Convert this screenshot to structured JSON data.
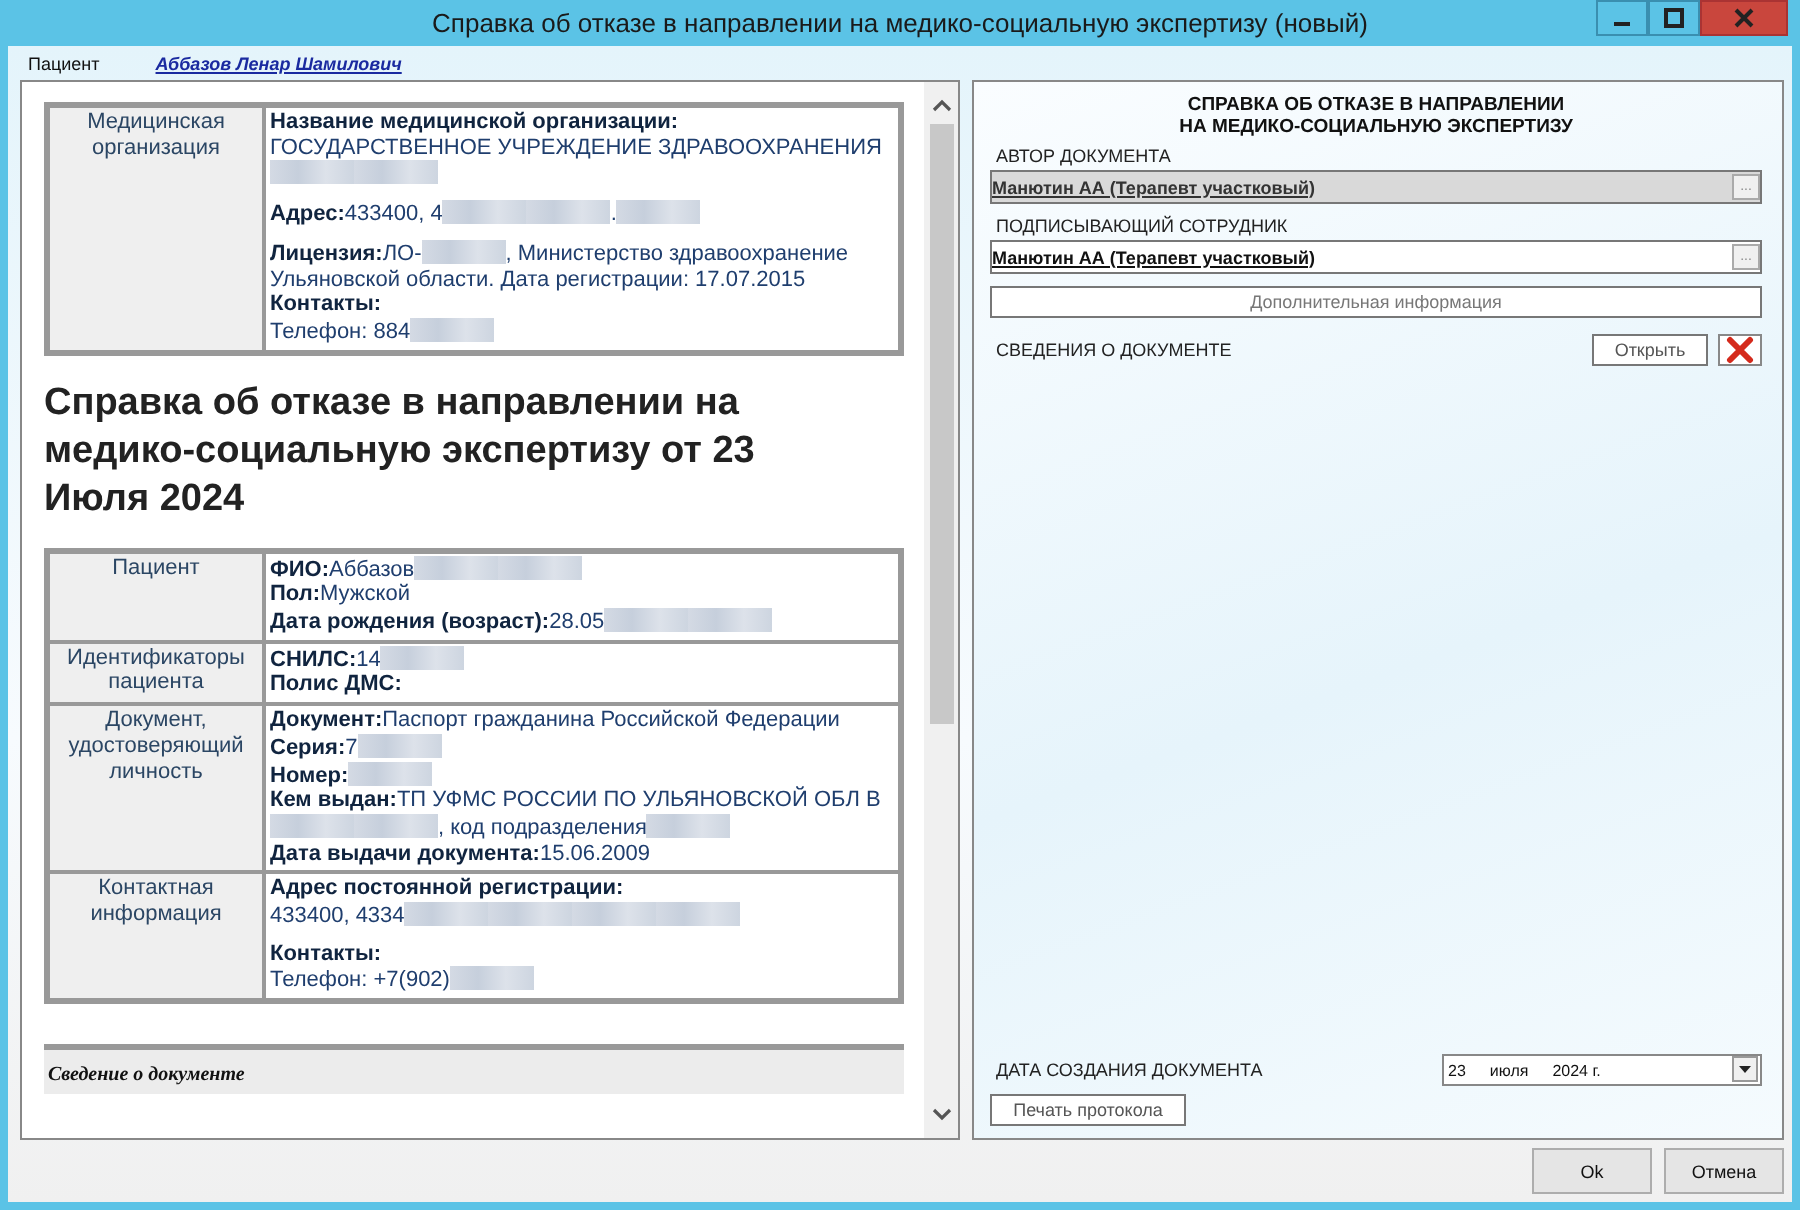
{
  "window": {
    "title": "Справка об отказе в направлении на медико-социальную экспертизу (новый)"
  },
  "patient": {
    "label": "Пациент",
    "name": "Аббазов Ленар Шамилович"
  },
  "document": {
    "org_table": [
      {
        "label": "Медицинская организация",
        "lines": [
          {
            "gap_before": false,
            "parts": [
              {
                "kind": "key",
                "text": "Название медицинской организации:"
              }
            ]
          },
          {
            "gap_before": false,
            "parts": [
              {
                "kind": "text",
                "text": "ГОСУДАРСТВЕННОЕ УЧРЕЖДЕНИЕ ЗДРАВООХРАНЕНИЯ"
              },
              {
                "kind": "blur"
              },
              {
                "kind": "blur"
              }
            ]
          },
          {
            "gap_before": true,
            "parts": [
              {
                "kind": "key",
                "text": "Адрес:"
              },
              {
                "kind": "text",
                "text": "433400, 4"
              },
              {
                "kind": "blur"
              },
              {
                "kind": "blur"
              },
              {
                "kind": "text",
                "text": "."
              },
              {
                "kind": "blur"
              }
            ]
          },
          {
            "gap_before": true,
            "parts": [
              {
                "kind": "key",
                "text": "Лицензия:"
              },
              {
                "kind": "text",
                "text": "ЛО-"
              },
              {
                "kind": "blur"
              },
              {
                "kind": "text",
                "text": ", Министерство здравоохранение Ульяновской области. Дата регистрации: 17.07.2015"
              }
            ]
          },
          {
            "gap_before": false,
            "parts": [
              {
                "kind": "key",
                "text": "Контакты:"
              }
            ]
          },
          {
            "gap_before": false,
            "parts": [
              {
                "kind": "text",
                "text": "Телефон: 884"
              },
              {
                "kind": "blur"
              }
            ]
          }
        ]
      }
    ],
    "heading": "Справка об отказе в направлении на медико-социальную экспертизу от 23 Июля 2024",
    "patient_table": [
      {
        "label": "Пациент",
        "lines": [
          {
            "gap_before": false,
            "parts": [
              {
                "kind": "key",
                "text": "ФИО:"
              },
              {
                "kind": "text",
                "text": "Аббазов"
              },
              {
                "kind": "blur"
              },
              {
                "kind": "blur"
              }
            ]
          },
          {
            "gap_before": false,
            "parts": [
              {
                "kind": "key",
                "text": "Пол:"
              },
              {
                "kind": "text",
                "text": "Мужской"
              }
            ]
          },
          {
            "gap_before": false,
            "parts": [
              {
                "kind": "key",
                "text": "Дата рождения (возраст):"
              },
              {
                "kind": "text",
                "text": "28.05"
              },
              {
                "kind": "blur"
              },
              {
                "kind": "blur"
              }
            ]
          }
        ]
      },
      {
        "label": "Идентификаторы пациента",
        "lines": [
          {
            "gap_before": false,
            "parts": [
              {
                "kind": "key",
                "text": "СНИЛС:"
              },
              {
                "kind": "text",
                "text": "14"
              },
              {
                "kind": "blur"
              }
            ]
          },
          {
            "gap_before": false,
            "parts": [
              {
                "kind": "key",
                "text": "Полис ДМС:"
              }
            ]
          }
        ]
      },
      {
        "label": "Документ, удостоверяющий личность",
        "lines": [
          {
            "gap_before": false,
            "parts": [
              {
                "kind": "key",
                "text": "Документ:"
              },
              {
                "kind": "text",
                "text": "Паспорт гражданина Российской Федерации"
              }
            ]
          },
          {
            "gap_before": false,
            "parts": [
              {
                "kind": "key",
                "text": "Серия:"
              },
              {
                "kind": "text",
                "text": "7"
              },
              {
                "kind": "blur"
              }
            ]
          },
          {
            "gap_before": false,
            "parts": [
              {
                "kind": "key",
                "text": "Номер:"
              },
              {
                "kind": "blur"
              }
            ]
          },
          {
            "gap_before": false,
            "parts": [
              {
                "kind": "key",
                "text": "Кем выдан:"
              },
              {
                "kind": "text",
                "text": "ТП УФМС РОССИИ ПО УЛЬЯНОВСКОЙ ОБЛ В"
              },
              {
                "kind": "blur"
              },
              {
                "kind": "blur"
              },
              {
                "kind": "text",
                "text": ", код подразделения"
              },
              {
                "kind": "blur"
              }
            ]
          },
          {
            "gap_before": false,
            "parts": [
              {
                "kind": "key",
                "text": "Дата выдачи документа:"
              },
              {
                "kind": "text",
                "text": "15.06.2009"
              }
            ]
          }
        ]
      },
      {
        "label": "Контактная информация",
        "lines": [
          {
            "gap_before": false,
            "parts": [
              {
                "kind": "key",
                "text": "Адрес постоянной регистрации:"
              }
            ]
          },
          {
            "gap_before": false,
            "parts": [
              {
                "kind": "text",
                "text": "433400, 4334"
              },
              {
                "kind": "blur"
              },
              {
                "kind": "blur"
              },
              {
                "kind": "blur"
              },
              {
                "kind": "blur"
              }
            ]
          },
          {
            "gap_before": true,
            "parts": [
              {
                "kind": "key",
                "text": "Контакты:"
              }
            ]
          },
          {
            "gap_before": false,
            "parts": [
              {
                "kind": "text",
                "text": "Телефон: +7(902)"
              },
              {
                "kind": "blur"
              }
            ]
          }
        ]
      }
    ],
    "footer_section": "Сведение о документе"
  },
  "form": {
    "title_lines": [
      "СПРАВКА ОБ ОТКАЗЕ В НАПРАВЛЕНИИ",
      "НА МЕДИКО-СОЦИАЛЬНУЮ ЭКСПЕРТИЗУ"
    ],
    "fields": [
      {
        "label": "АВТОР ДОКУМЕНТА",
        "value": "Манютин АА (Терапевт участковый)",
        "browse": "...",
        "disabled": true
      },
      {
        "label": "ПОДПИСЫВАЮЩИЙ СОТРУДНИК",
        "value": "Манютин АА (Терапевт участковый)",
        "browse": "...",
        "disabled": false
      }
    ],
    "extra_button": "Дополнительная информация",
    "doc_info": {
      "label": "СВЕДЕНИЯ О ДОКУМЕНТЕ",
      "open_button": "Открыть"
    },
    "date": {
      "label": "ДАТА СОЗДАНИЯ ДОКУМЕНТА",
      "day": "23",
      "month": "июля",
      "year": "2024 г."
    },
    "print_button": "Печать протокола"
  },
  "buttons": [
    "Ok",
    "Отмена"
  ]
}
